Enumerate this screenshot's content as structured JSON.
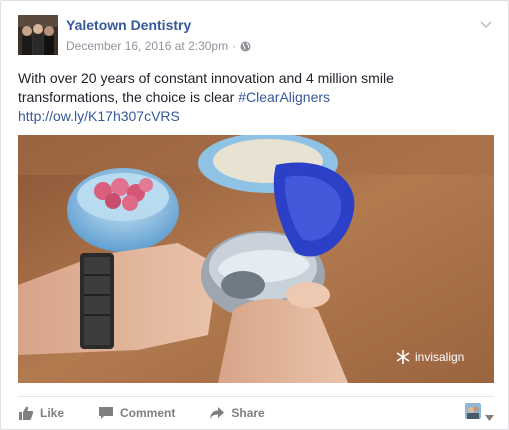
{
  "post": {
    "page_name": "Yaletown Dentistry",
    "date": "December 16, 2016 at 2:30pm",
    "separator": "·",
    "text_main": "With over 20 years of constant innovation and 4 million smile transformations, the choice is clear ",
    "hashtag": "#ClearAligners",
    "link": "http://ow.ly/K17h307cVRS",
    "image_watermark": "invisalign"
  },
  "actions": {
    "like": "Like",
    "comment": "Comment",
    "share": "Share"
  },
  "colors": {
    "link": "#365899",
    "meta": "#90949c",
    "action": "#7f7f7f"
  },
  "icons": {
    "globe": "globe-icon",
    "options": "chevron-down-icon",
    "like": "thumbs-up-icon",
    "comment": "comment-icon",
    "share": "share-arrow-icon",
    "audience": "profile-picture-icon"
  }
}
